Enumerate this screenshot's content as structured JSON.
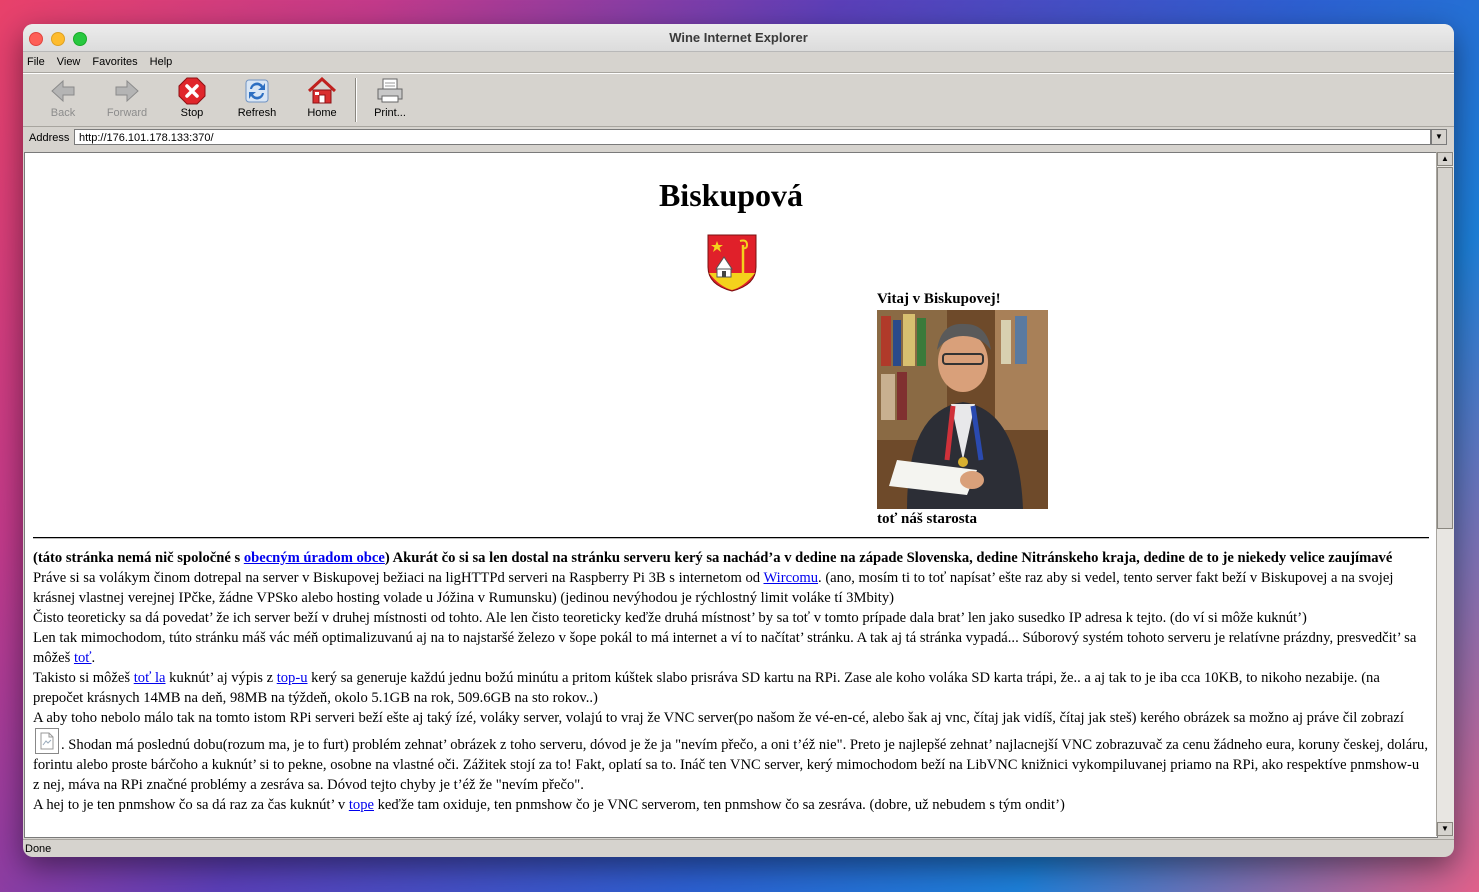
{
  "window": {
    "title": "Wine Internet Explorer"
  },
  "menu": [
    "File",
    "View",
    "Favorites",
    "Help"
  ],
  "toolbar": {
    "back": "Back",
    "forward": "Forward",
    "stop": "Stop",
    "refresh": "Refresh",
    "home": "Home",
    "print": "Print..."
  },
  "address": {
    "label": "Address",
    "url": "http://176.101.178.133:370/"
  },
  "status": "Done",
  "page": {
    "title": "Biskupová",
    "welcome": "Vitaj v Biskupovej!",
    "caption": "toť náš starosta",
    "p1": {
      "a": "(táto stránka nemá nič spoločné s ",
      "link": "obecným úradom obce",
      "b": ") Akurát čo si sa len dostal na stránku serveru kerý sa nachád’a v dedine na západe Slovenska, dedine Nitránskeho kraja, dedine de to je niekedy velice zaujímavé"
    },
    "p2": {
      "a": "Práve si sa volákym činom dotrepal na server v Biskupovej bežiaci na ligHTTPd serveri na Raspberry Pi 3B s internetom od ",
      "link": "Wircomu",
      "b": ". (ano, mosím ti to toť napísat’ ešte raz aby si vedel, tento server fakt beží v Biskupovej a na svojej krásnej vlastnej verejnej IPčke, žádne VPSko alebo hosting volade u Jóžina v Rumunsku) (jedinou nevýhodou je rýchlostný limit voláke tí 3Mbity)"
    },
    "p3": "Čisto teoreticky sa dá povedat’ že ich server beží v druhej místnosti od tohto. Ale len čisto teoreticky keďže druhá místnost’ by sa toť v tomto prípade dala brat’ len jako susedko IP adresa k tejto. (do ví si môže kuknút’)",
    "p4": {
      "a": "Len tak mimochodom, túto stránku máš vác méň optimalizuvanú aj na to najstaršé železo v šope pokál to má internet a ví to načítat’ stránku. A tak aj tá stránka vypadá... Súborový systém tohoto serveru je relatívne prázdny, presvedčit’ sa môžeš ",
      "link": "toť",
      "b": "."
    },
    "p5": {
      "a": "Takisto si môžeš ",
      "link1": "toť la",
      "b": " kuknút’ aj výpis z ",
      "link2": "top-u",
      "c": " kerý sa generuje každú jednu božú minútu a pritom kúštek slabo prisráva SD kartu na RPi. Zase ale koho voláka SD karta trápi, že.. a aj tak to je iba cca 10KB, to nikoho nezabije. (na prepočet krásnych 14MB na deň, 98MB na týždeň, okolo 5.1GB na rok, 509.6GB na sto rokov..)"
    },
    "p6": {
      "a": "A aby toho nebolo málo tak na tomto istom RPi serveri beží ešte aj taký ízé, voláky server, volajú to vraj že VNC server(po našom že vé-en-cé, alebo šak aj vnc, čítaj jak vidíš, čítaj jak steš) kerého obrázek sa možno aj práve čil zobrazí ",
      "b": ". Shodan má poslednú dobu(rozum ma, je to furt) problém zehnat’ obrázek z toho serveru, dóvod je že ja \"nevím přečo, a oni t’éž nie\". Preto je najlepšé zehnat’ najlacnejší VNC zobrazuvač za cenu žádneho eura, koruny českej, doláru, forintu alebo proste bárčoho a kuknút’ si to pekne, osobne na vlastné oči. Zážitek stojí za to! Fakt, oplatí sa to. Ináč ten VNC server, kerý mimochodom beží na LibVNC knižnici vykompiluvanej priamo na RPi, ako respektíve pnmshow-u z nej, máva na RPi značné problémy a zesráva sa. Dóvod tejto chyby je t’éž že \"nevím přečo\"."
    },
    "p7": {
      "a": "A hej to je ten pnmshow čo sa dá raz za čas kuknút’ v ",
      "link": "tope",
      "b": " keďže tam oxiduje, ten pnmshow čo je VNC serverom, ten pnmshow čo sa zesráva. (dobre, už nebudem s tým ondit’)"
    }
  }
}
